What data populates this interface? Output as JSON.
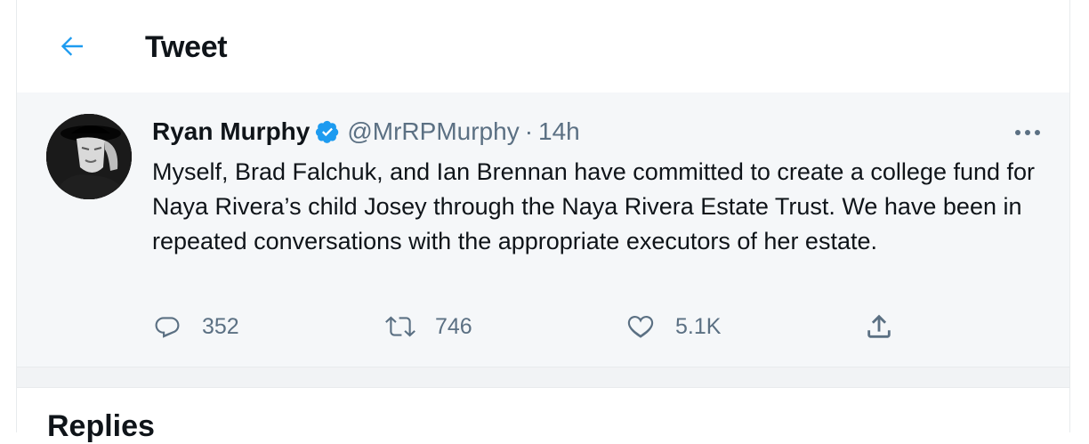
{
  "header": {
    "title": "Tweet",
    "back_icon": "arrow-left-icon"
  },
  "tweet": {
    "author": {
      "display_name": "Ryan Murphy",
      "verified": true,
      "handle": "@MrRPMurphy"
    },
    "separator": "·",
    "time": "14h",
    "text": "Myself, Brad Falchuk, and Ian Brennan have committed to create a college fund for Naya Rivera’s child Josey through the Naya Rivera Estate Trust. We have been in repeated conversations with the appropriate executors of her estate.",
    "actions": {
      "reply_count": "352",
      "retweet_count": "746",
      "like_count": "5.1K"
    }
  },
  "replies": {
    "heading": "Replies"
  },
  "colors": {
    "accent": "#1d9bf0",
    "text": "#0f1419",
    "secondary": "#5b7083",
    "tweet_bg": "#f5f7f9"
  }
}
